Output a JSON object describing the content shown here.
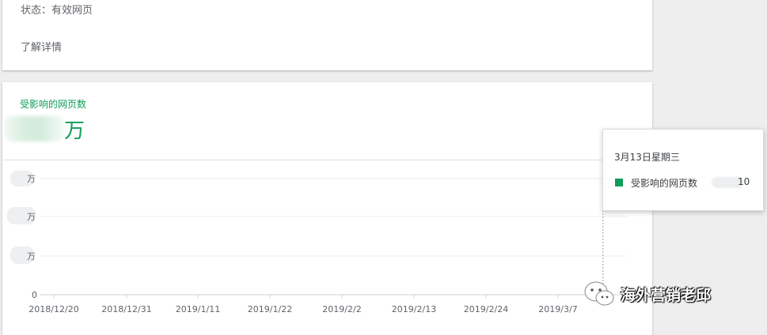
{
  "top_card": {
    "status_text": "状态：有效网页",
    "learn_more_label": "了解详情"
  },
  "metric": {
    "label": "受影响的网页数",
    "unit": "万"
  },
  "chart_data": {
    "type": "bar",
    "x_ticks": [
      "2018/12/20",
      "2018/12/31",
      "2019/1/11",
      "2019/1/22",
      "2019/2/2",
      "2019/2/13",
      "2019/2/24",
      "2019/3/7"
    ],
    "y_ticks": [
      "0",
      "万",
      "万",
      "万"
    ],
    "values": [
      0,
      0,
      0,
      0,
      0,
      0,
      0,
      0,
      0,
      0,
      0,
      0,
      0,
      0,
      0,
      0,
      0,
      0,
      0,
      0,
      0,
      0,
      0,
      0,
      0,
      0,
      0,
      0,
      0,
      0,
      0,
      0,
      0,
      0,
      0,
      0,
      0,
      0,
      0,
      0,
      0,
      0,
      0,
      0,
      0,
      0,
      0,
      0,
      0,
      0,
      0,
      0,
      0,
      0,
      0,
      0,
      0,
      0,
      0,
      0,
      0,
      0,
      0,
      0,
      0,
      0,
      0,
      0,
      0,
      0,
      0,
      0,
      0,
      0,
      0,
      0,
      0,
      0,
      0,
      0,
      0,
      0,
      0,
      0
    ],
    "color": "#0f9d58",
    "grid": true
  },
  "tooltip": {
    "date": "3月13日星期三",
    "series_name": "受影响的网页数",
    "value_suffix": "10"
  },
  "watermark": {
    "text": "海外营销老邱",
    "icon": "wechat-icon"
  }
}
